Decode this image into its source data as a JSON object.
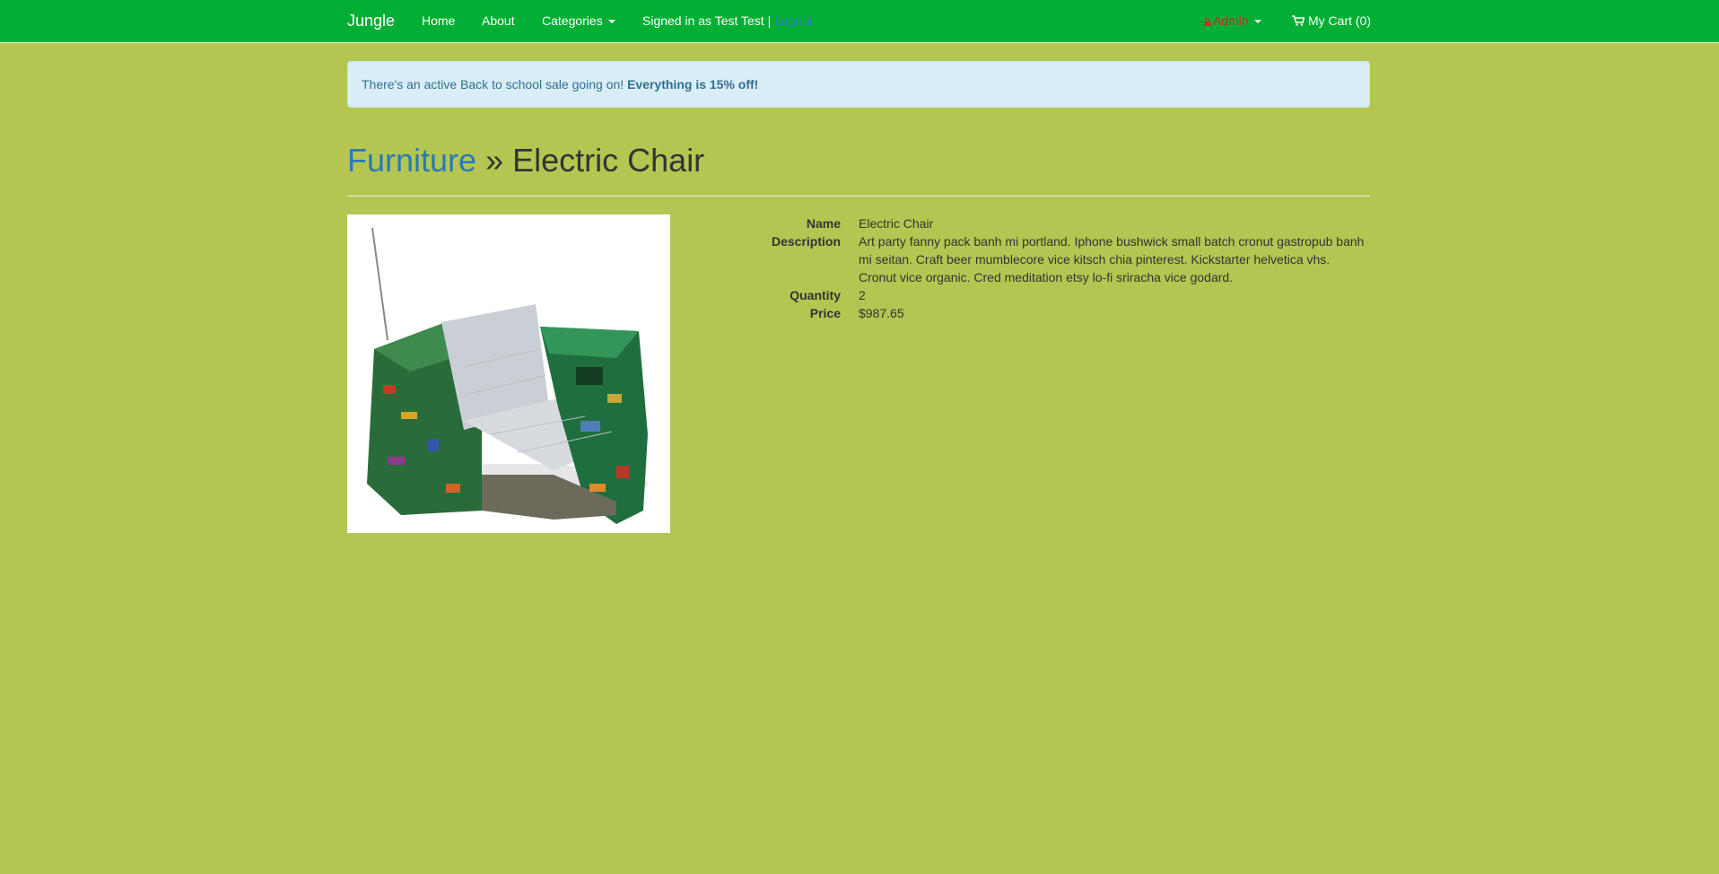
{
  "nav": {
    "brand": "Jungle",
    "home": "Home",
    "about": "About",
    "categories": "Categories",
    "signed_in": "Signed in as Test Test |",
    "logout": "Logout",
    "admin": "Admin",
    "cart": "My Cart (0)"
  },
  "alert": {
    "text": "There's an active Back to school sale going on!",
    "emphasis": "Everything is 15% off!"
  },
  "header": {
    "category": "Furniture",
    "separator": "»",
    "product": "Electric Chair"
  },
  "product": {
    "name_label": "Name",
    "name": "Electric Chair",
    "description_label": "Description",
    "description": "Art party fanny pack banh mi portland. Iphone bushwick small batch cronut gastropub banh mi seitan. Craft beer mumblecore vice kitsch chia pinterest. Kickstarter helvetica vhs. Cronut vice organic. Cred meditation etsy lo-fi sriracha vice godard.",
    "quantity_label": "Quantity",
    "quantity": "2",
    "price_label": "Price",
    "price": "$987.65"
  },
  "colors": {
    "navbar": "#00af33",
    "page_background": "#b4c651",
    "alert_background": "#d9edf7",
    "link": "#2a7ab8",
    "admin": "#c9302c"
  },
  "icons": {
    "admin": "lock-icon",
    "cart": "shopping-cart-icon",
    "dropdown": "caret-down-icon"
  }
}
